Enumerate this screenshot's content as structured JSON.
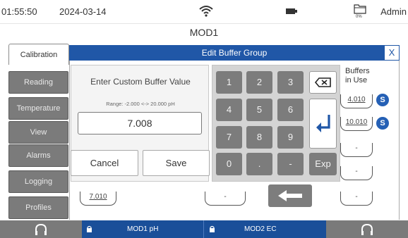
{
  "status": {
    "time": "01:55:50",
    "date": "2024-03-14",
    "user": "Admin",
    "storage_label": "0%"
  },
  "title": "MOD1",
  "nav": {
    "calibration_tab": "Calibration",
    "items": [
      "Reading",
      "Temperature",
      "View",
      "Alarms",
      "Logging",
      "Profiles"
    ]
  },
  "dialog": {
    "title": "Edit Buffer Group",
    "close": "X",
    "custom": {
      "heading": "Enter Custom Buffer Value",
      "range": "Range: -2.000 <-> 20.000 pH",
      "value": "7.008",
      "cancel": "Cancel",
      "save": "Save"
    },
    "keypad": {
      "keys": [
        "1",
        "2",
        "3",
        "4",
        "5",
        "6",
        "7",
        "8",
        "9",
        "0",
        ".",
        "-"
      ],
      "exp": "Exp"
    }
  },
  "background": {
    "buffers_label_1": "Buffers",
    "buffers_label_2": "in Use",
    "buffer_values": [
      "4.010",
      "10.010",
      "-",
      "-",
      "-"
    ],
    "s_badge": "S",
    "left_value": "7.010",
    "mid_value": "-"
  },
  "bottom": {
    "mod1": "MOD1 pH",
    "mod2": "MOD2 EC"
  },
  "colors": {
    "accent": "#2057a7",
    "bottom_bar": "#1a4f99",
    "badge": "#2560b5"
  }
}
